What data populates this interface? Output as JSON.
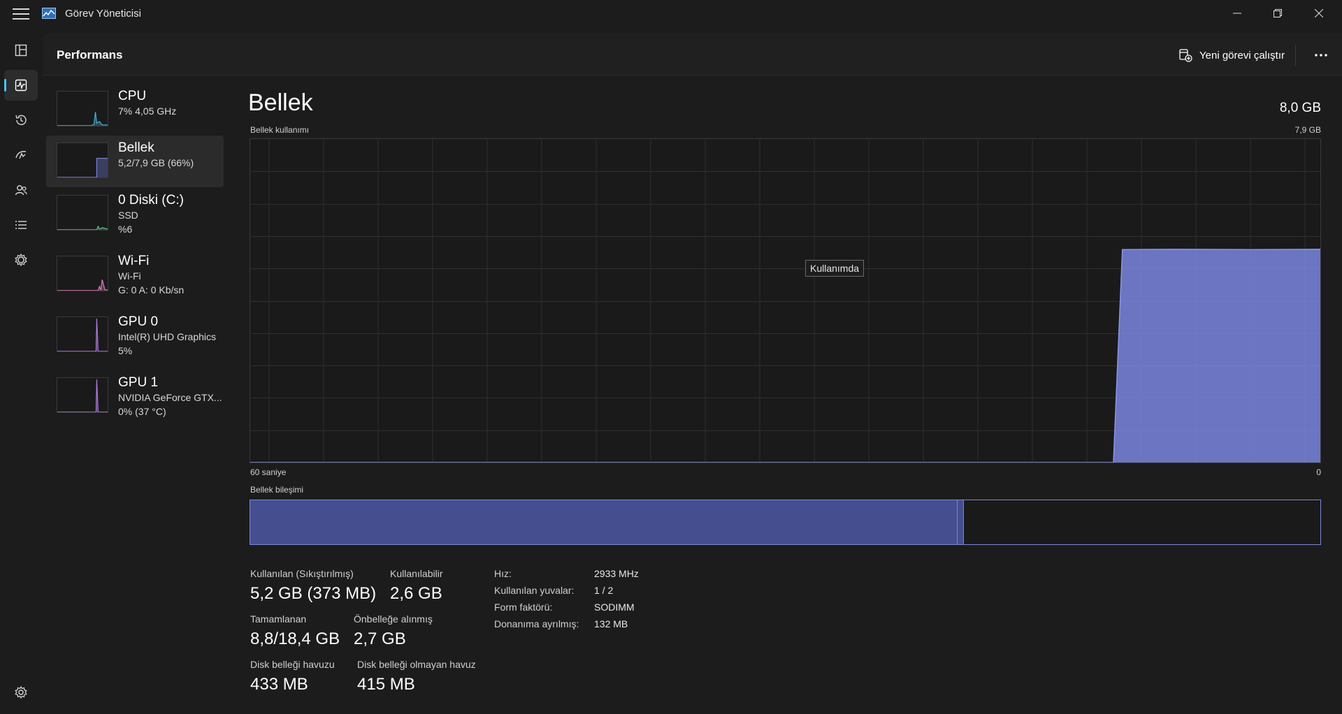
{
  "window": {
    "title": "Görev Yöneticisi"
  },
  "header": {
    "title": "Performans",
    "run_new_task": "Yeni görevi çalıştır"
  },
  "rail": {
    "items": [
      "processes-icon",
      "performance-icon",
      "app-history-icon",
      "startup-apps-icon",
      "users-icon",
      "details-icon",
      "services-icon"
    ],
    "settings": "settings-icon"
  },
  "resources": [
    {
      "name": "CPU",
      "line1": "7%  4,05 GHz",
      "line2": "",
      "color": "#4ab2d8"
    },
    {
      "name": "Bellek",
      "line1": "5,2/7,9 GB (66%)",
      "line2": "",
      "color": "#7b86e0"
    },
    {
      "name": "0 Diski (C:)",
      "line1": "SSD",
      "line2": "%6",
      "color": "#5fbf8f"
    },
    {
      "name": "Wi-Fi",
      "line1": "Wi-Fi",
      "line2": "G: 0  A: 0 Kb/sn",
      "color": "#e07ab8"
    },
    {
      "name": "GPU 0",
      "line1": "Intel(R) UHD Graphics",
      "line2": "5%",
      "color": "#b07ae0"
    },
    {
      "name": "GPU 1",
      "line1": "NVIDIA GeForce GTX...",
      "line2": "0%  (37 °C)",
      "color": "#b07ae0"
    }
  ],
  "detail": {
    "title": "Bellek",
    "total": "8,0 GB",
    "usage_label": "Bellek kullanımı",
    "usage_max": "7,9 GB",
    "time_left": "60 saniye",
    "time_right": "0",
    "tooltip": "Kullanımda",
    "composition_label": "Bellek bileşimi",
    "composition": {
      "in_use_fraction": 0.661,
      "modified_fraction": 0.006,
      "fill_color": "#454e8e",
      "border_color": "#7a86d6"
    }
  },
  "chart_data": {
    "type": "area",
    "title": "Bellek kullanımı",
    "xlabel": "",
    "ylabel": "",
    "x_range_label": [
      "60 saniye",
      "0"
    ],
    "ylim": [
      0,
      7.9
    ],
    "unit": "GB",
    "x": [
      60,
      57,
      54,
      51,
      48,
      45,
      42,
      39,
      36,
      33,
      30,
      27,
      24,
      21,
      18,
      15,
      12,
      9,
      6,
      3,
      0
    ],
    "values": [
      0,
      0,
      0,
      0,
      0,
      0,
      0,
      0,
      0,
      0,
      0,
      0,
      0,
      0,
      0,
      0,
      0,
      0,
      0,
      0,
      0
    ],
    "series": [
      {
        "x": [
          60,
          48,
          36,
          24,
          12,
          11.6,
          11.1,
          8,
          4,
          0
        ],
        "values": [
          0,
          0,
          0,
          0,
          0,
          0,
          5.2,
          5.21,
          5.2,
          5.21
        ]
      }
    ],
    "grid": true,
    "color": "#7b86e0"
  },
  "stats": {
    "in_use_label": "Kullanılan (Sıkıştırılmış)",
    "in_use_value": "5,2 GB (373 MB)",
    "available_label": "Kullanılabilir",
    "available_value": "2,6 GB",
    "committed_label": "Tamamlanan",
    "committed_value": "8,8/18,4 GB",
    "cached_label": "Önbelleğe alınmış",
    "cached_value": "2,7 GB",
    "paged_label": "Disk belleği havuzu",
    "paged_value": "433 MB",
    "nonpaged_label": "Disk belleği olmayan havuz",
    "nonpaged_value": "415 MB"
  },
  "specs": [
    {
      "label": "Hız:",
      "value": "2933 MHz"
    },
    {
      "label": "Kullanılan yuvalar:",
      "value": "1 / 2"
    },
    {
      "label": "Form faktörü:",
      "value": "SODIMM"
    },
    {
      "label": "Donanıma ayrılmış:",
      "value": "132 MB"
    }
  ]
}
